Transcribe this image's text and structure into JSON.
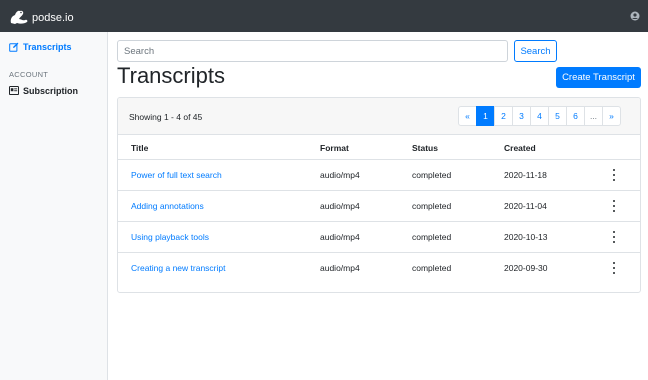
{
  "app": {
    "brand": "podse.io"
  },
  "sidebar": {
    "items": [
      {
        "label": "Transcripts"
      }
    ],
    "section_label": "ACCOUNT",
    "account_items": [
      {
        "label": "Subscription"
      }
    ]
  },
  "search": {
    "placeholder": "Search",
    "button_label": "Search"
  },
  "page": {
    "title": "Transcripts",
    "create_label": "Create Transcript"
  },
  "list": {
    "showing_text": "Showing 1 - 4 of 45",
    "pagination": [
      "«",
      "1",
      "2",
      "3",
      "4",
      "5",
      "6",
      "...",
      "»"
    ],
    "active_page": "1",
    "columns": [
      "Title",
      "Format",
      "Status",
      "Created"
    ],
    "rows": [
      {
        "title": "Power of full text search",
        "format": "audio/mp4",
        "status": "completed",
        "created": "2020-11-18"
      },
      {
        "title": "Adding annotations",
        "format": "audio/mp4",
        "status": "completed",
        "created": "2020-11-04"
      },
      {
        "title": "Using playback tools",
        "format": "audio/mp4",
        "status": "completed",
        "created": "2020-10-13"
      },
      {
        "title": "Creating a new transcript",
        "format": "audio/mp4",
        "status": "completed",
        "created": "2020-09-30"
      }
    ]
  },
  "icons": {
    "brand": "seal-logo-icon",
    "user": "user-circle-icon",
    "transcripts": "edit-square-icon",
    "subscription": "id-card-icon",
    "row_menu": "vertical-ellipsis-icon"
  },
  "colors": {
    "accent": "#007bff",
    "topbar": "#343a40",
    "sidebar": "#f8f9fa"
  }
}
